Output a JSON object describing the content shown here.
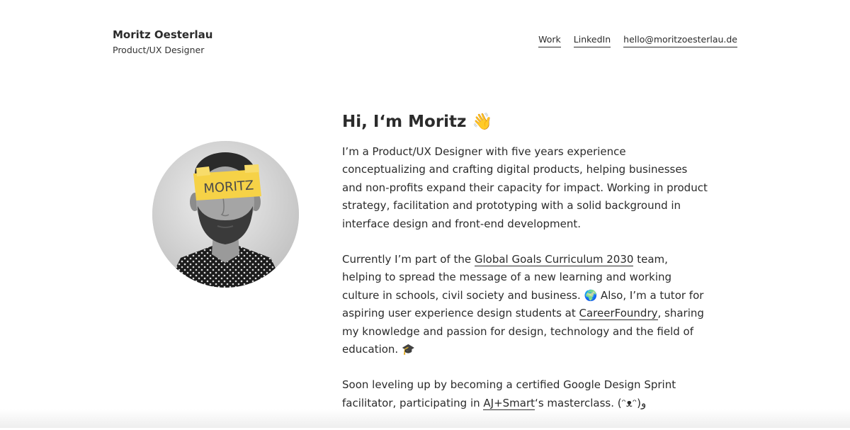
{
  "header": {
    "name": "Moritz Oesterlau",
    "role": "Product/UX Designer"
  },
  "nav": {
    "work": "Work",
    "linkedin": "LinkedIn",
    "email": "hello@moritzoesterlau.de"
  },
  "avatar": {
    "sticky_note_text": "MORITZ"
  },
  "intro": {
    "heading": "Hi, I‘m Moritz 👋",
    "p1": "I’m a Product/UX Designer with five years experience conceptualizing and crafting digital products, helping businesses and non-profits expand their capacity for impact. Working in product strategy, facilitation and prototyping with a solid background in interface design and front-end development.",
    "p2_before": "Currently I’m part of the ",
    "p2_link1": "Global Goals Curriculum 2030",
    "p2_mid": " team, helping to spread the message of a new learning and working culture in schools, civil society and business. 🌍 Also, I’m a tutor for aspiring user experience design students at ",
    "p2_link2": "CareerFoundry",
    "p2_after": ", sharing my knowledge and passion for design, technology and the field of education. 🎓",
    "p3_before": "Soon leveling up by becoming a certified Google Design Sprint facilitator, participating in ",
    "p3_link": "AJ+Smart",
    "p3_after": "‘s masterclass. (ᵔᴥᵔ)و"
  },
  "colors": {
    "text": "#2b2b2b",
    "background": "#ffffff",
    "sticky_note": "#f6d247"
  }
}
